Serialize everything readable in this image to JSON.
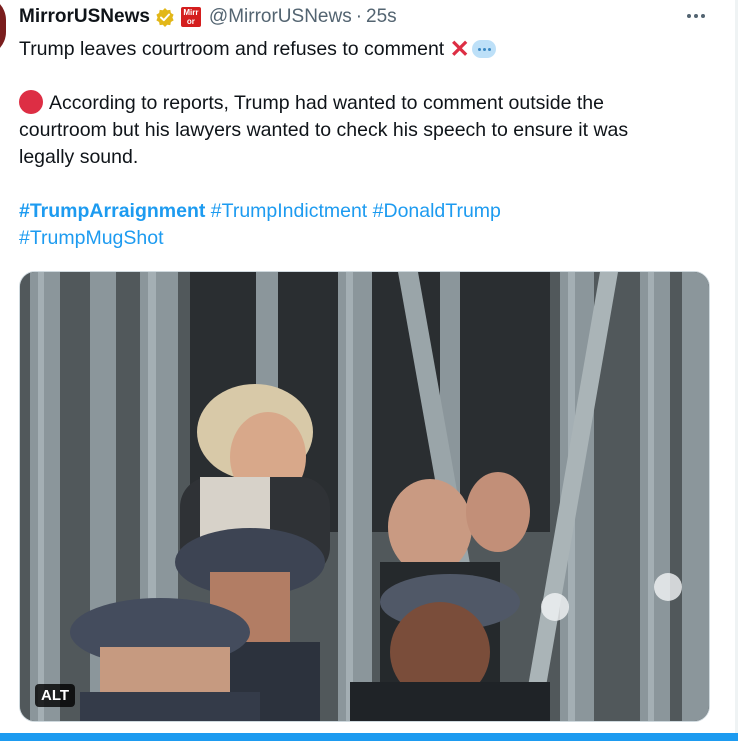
{
  "tweet": {
    "author_name": "MirrorUSNews",
    "brand_badge_text": "Mirror",
    "handle": "@MirrorUSNews",
    "separator": "·",
    "timestamp": "25s",
    "icons": {
      "verified": "verified-badge-icon",
      "more": "more-options-icon"
    },
    "colors": {
      "link": "#1d9bf0",
      "verified_gold": "#e2b719",
      "brand_red": "#d41e1e"
    },
    "line1": "Trump leaves courtroom and refuses to comment",
    "para2_line1": "According to reports, Trump had wanted to comment outside the",
    "para2_line2": "courtroom but his lawyers wanted to check his speech to ensure it was",
    "para2_line3": "legally sound.",
    "hashtags": [
      "#TrumpArraignment",
      "#TrumpIndictment",
      "#DonaldTrump",
      "#TrumpMugShot"
    ]
  },
  "media": {
    "alt_label": "ALT"
  }
}
